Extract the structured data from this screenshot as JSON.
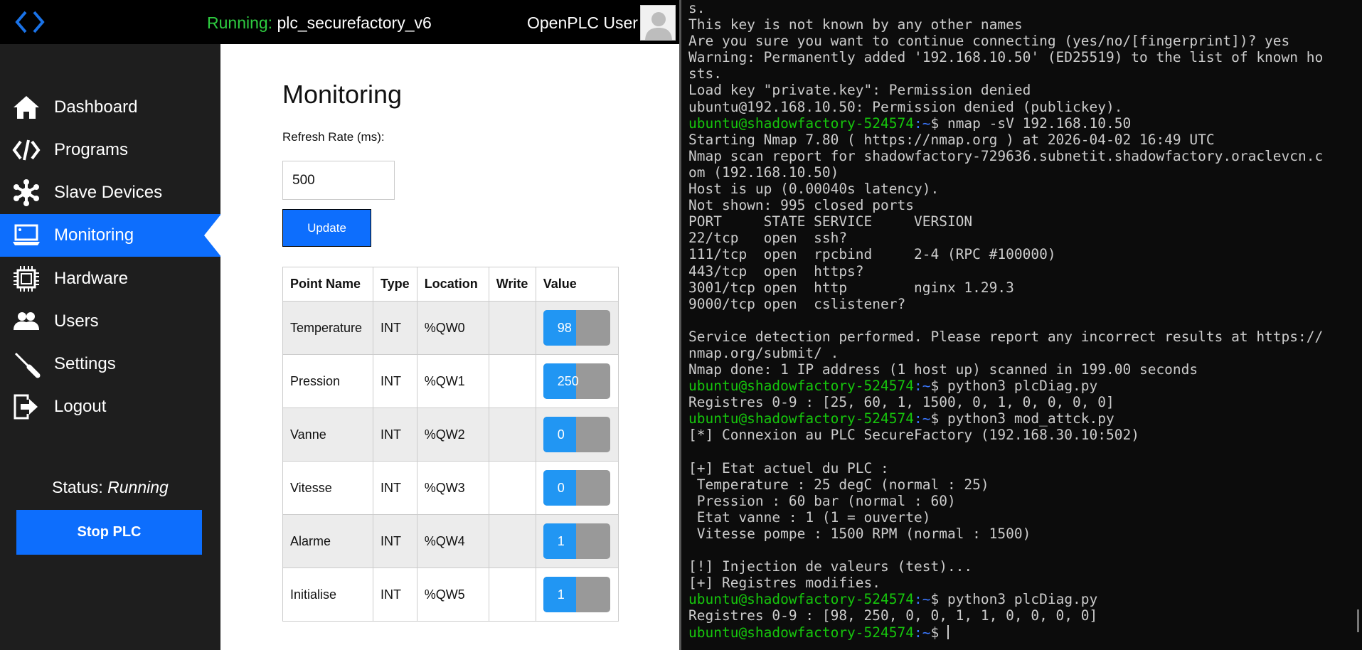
{
  "header": {
    "running_label": "Running:",
    "program_name": "plc_securefactory_v6",
    "user_name": "OpenPLC User"
  },
  "sidebar": {
    "items": [
      {
        "label": "Dashboard",
        "icon": "home-icon"
      },
      {
        "label": "Programs",
        "icon": "code-icon"
      },
      {
        "label": "Slave Devices",
        "icon": "network-icon"
      },
      {
        "label": "Monitoring",
        "icon": "monitor-icon",
        "active": true
      },
      {
        "label": "Hardware",
        "icon": "chip-icon"
      },
      {
        "label": "Users",
        "icon": "users-icon"
      },
      {
        "label": "Settings",
        "icon": "wrench-icon"
      },
      {
        "label": "Logout",
        "icon": "logout-icon"
      }
    ],
    "status_label": "Status:",
    "status_value": "Running",
    "stop_button": "Stop PLC"
  },
  "main": {
    "title": "Monitoring",
    "refresh_label": "Refresh Rate (ms):",
    "refresh_value": "500",
    "update_button": "Update",
    "table": {
      "headers": [
        "Point Name",
        "Type",
        "Location",
        "Write",
        "Value"
      ],
      "rows": [
        {
          "name": "Temperature",
          "type": "INT",
          "location": "%QW0",
          "write": "",
          "value": "98"
        },
        {
          "name": "Pression",
          "type": "INT",
          "location": "%QW1",
          "write": "",
          "value": "250"
        },
        {
          "name": "Vanne",
          "type": "INT",
          "location": "%QW2",
          "write": "",
          "value": "0"
        },
        {
          "name": "Vitesse",
          "type": "INT",
          "location": "%QW3",
          "write": "",
          "value": "0"
        },
        {
          "name": "Alarme",
          "type": "INT",
          "location": "%QW4",
          "write": "",
          "value": "1"
        },
        {
          "name": "Initialise",
          "type": "INT",
          "location": "%QW5",
          "write": "",
          "value": "1"
        }
      ]
    }
  },
  "terminal": {
    "prompt_user": "ubuntu@shadowfactory-524574",
    "prompt_path": ":~",
    "prompt_symbol": "$ ",
    "lines": [
      {
        "text": "s."
      },
      {
        "text": "This key is not known by any other names"
      },
      {
        "text": "Are you sure you want to continue connecting (yes/no/[fingerprint])? yes"
      },
      {
        "text": "Warning: Permanently added '192.168.10.50' (ED25519) to the list of known ho"
      },
      {
        "text": "sts."
      },
      {
        "text": "Load key \"private.key\": Permission denied"
      },
      {
        "text": "ubuntu@192.168.10.50: Permission denied (publickey)."
      },
      {
        "prompt": true,
        "text": "nmap -sV 192.168.10.50"
      },
      {
        "text": "Starting Nmap 7.80 ( https://nmap.org ) at 2026-04-02 16:49 UTC"
      },
      {
        "text": "Nmap scan report for shadowfactory-729636.subnetit.shadowfactory.oraclevcn.c"
      },
      {
        "text": "om (192.168.10.50)"
      },
      {
        "text": "Host is up (0.00040s latency)."
      },
      {
        "text": "Not shown: 995 closed ports"
      },
      {
        "text": "PORT     STATE SERVICE     VERSION"
      },
      {
        "text": "22/tcp   open  ssh?"
      },
      {
        "text": "111/tcp  open  rpcbind     2-4 (RPC #100000)"
      },
      {
        "text": "443/tcp  open  https?"
      },
      {
        "text": "3001/tcp open  http        nginx 1.29.3"
      },
      {
        "text": "9000/tcp open  cslistener?"
      },
      {
        "text": ""
      },
      {
        "text": "Service detection performed. Please report any incorrect results at https://"
      },
      {
        "text": "nmap.org/submit/ ."
      },
      {
        "text": "Nmap done: 1 IP address (1 host up) scanned in 199.00 seconds"
      },
      {
        "prompt": true,
        "text": "python3 plcDiag.py"
      },
      {
        "text": "Registres 0-9 : [25, 60, 1, 1500, 0, 1, 0, 0, 0, 0]"
      },
      {
        "prompt": true,
        "text": "python3 mod_attck.py"
      },
      {
        "text": "[*] Connexion au PLC SecureFactory (192.168.30.10:502)"
      },
      {
        "text": ""
      },
      {
        "text": "[+] Etat actuel du PLC :"
      },
      {
        "text": " Temperature : 25 degC (normal : 25)"
      },
      {
        "text": " Pression : 60 bar (normal : 60)"
      },
      {
        "text": " Etat vanne : 1 (1 = ouverte)"
      },
      {
        "text": " Vitesse pompe : 1500 RPM (normal : 1500)"
      },
      {
        "text": ""
      },
      {
        "text": "[!] Injection de valeurs (test)..."
      },
      {
        "text": "[+] Registres modifies."
      },
      {
        "prompt": true,
        "text": "python3 plcDiag.py"
      },
      {
        "text": "Registres 0-9 : [98, 250, 0, 0, 1, 1, 0, 0, 0, 0]"
      },
      {
        "prompt": true,
        "text": "",
        "cursor": true
      }
    ]
  },
  "colors": {
    "accent_blue": "#0d6efd",
    "value_blue": "#2196f3",
    "running_green": "#2ecc40",
    "prompt_green": "#16c60c",
    "prompt_blue": "#3b78ff",
    "sidebar_bg": "#1e1e1e",
    "terminal_bg": "#0c0c0c"
  }
}
